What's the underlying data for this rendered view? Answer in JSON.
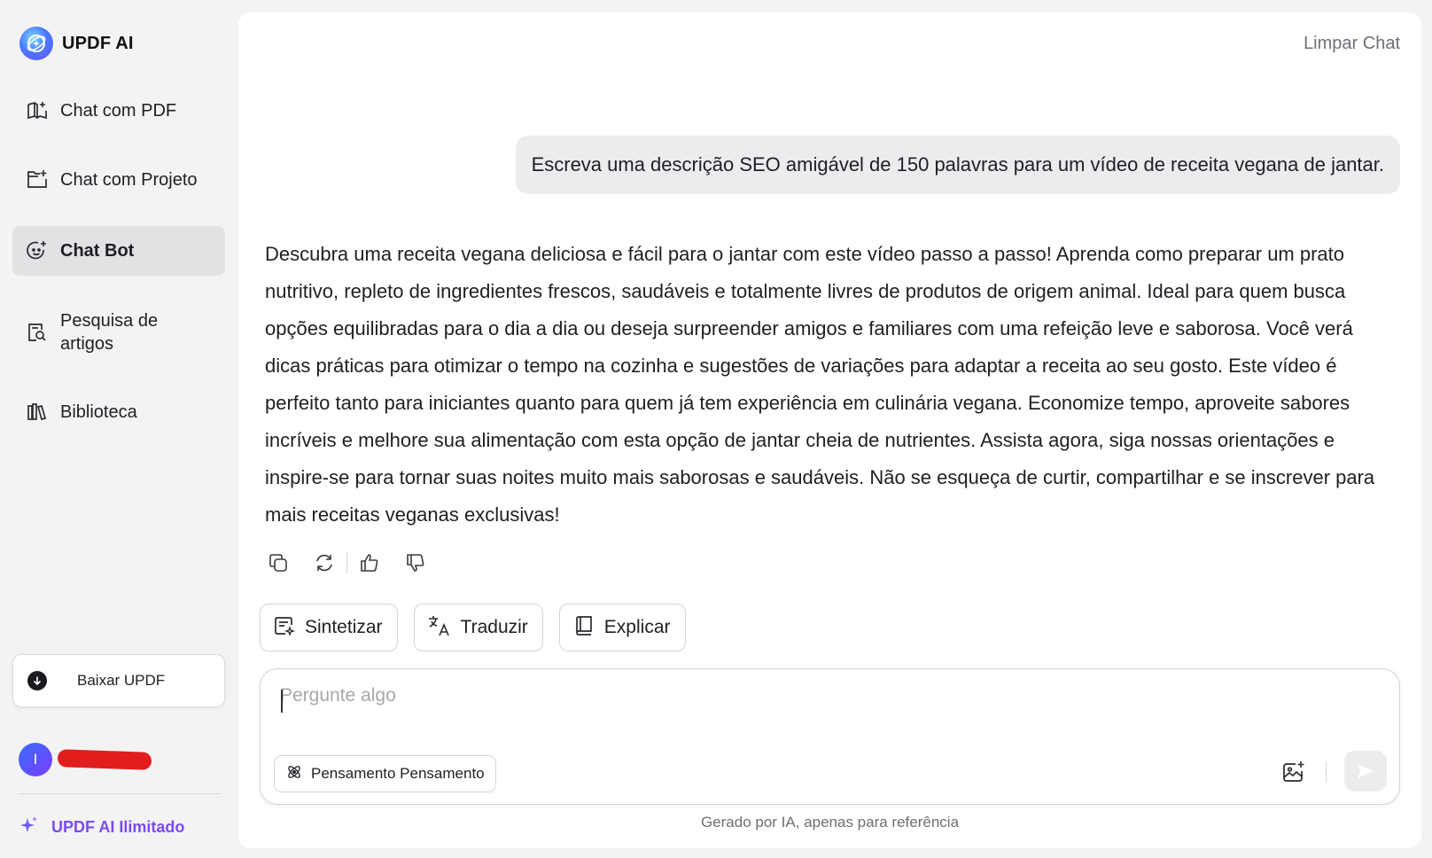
{
  "brand": {
    "name": "UPDF AI"
  },
  "sidebar": {
    "items": [
      {
        "label": "Chat com PDF",
        "icon": "book-sparkle-icon"
      },
      {
        "label": "Chat com Projeto",
        "icon": "folder-sparkle-icon"
      },
      {
        "label": "Chat Bot",
        "icon": "chatbot-icon",
        "active": true
      },
      {
        "label": "Pesquisa de artigos",
        "icon": "article-search-icon"
      },
      {
        "label": "Biblioteca",
        "icon": "library-icon"
      }
    ],
    "download_label": "Baixar UPDF",
    "user_initial": "I",
    "upgrade_label": "UPDF AI Ilimitado"
  },
  "header": {
    "clear_chat": "Limpar Chat"
  },
  "chat": {
    "user_message": "Escreva uma descrição SEO amigável de 150 palavras para um vídeo de receita vegana de jantar.",
    "bot_message": "Descubra uma receita vegana deliciosa e fácil para o jantar com este vídeo passo a passo! Aprenda como preparar um prato nutritivo, repleto de ingredientes frescos, saudáveis e totalmente livres de produtos de origem animal. Ideal para quem busca opções equilibradas para o dia a dia ou deseja surpreender amigos e familiares com uma refeição leve e saborosa. Você verá dicas práticas para otimizar o tempo na cozinha e sugestões de variações para adaptar a receita ao seu gosto. Este vídeo é perfeito tanto para iniciantes quanto para quem já tem experiência em culinária vegana. Economize tempo, aproveite sabores incríveis e melhore sua alimentação com esta opção de jantar cheia de nutrientes. Assista agora, siga nossas orientações e inspire-se para tornar suas noites muito mais saborosas e saudáveis. Não se esqueça de curtir, compartilhar e se inscrever para mais receitas veganas exclusivas!",
    "actions": [
      "copy-icon",
      "regenerate-icon",
      "thumbs-up-icon",
      "thumbs-down-icon"
    ]
  },
  "quick_actions": [
    {
      "label": "Sintetizar",
      "icon": "summarize-icon"
    },
    {
      "label": "Traduzir",
      "icon": "translate-icon"
    },
    {
      "label": "Explicar",
      "icon": "book-icon"
    }
  ],
  "input": {
    "placeholder": "Pergunte algo",
    "value": "",
    "thinking_label": "Pensamento Pensamento"
  },
  "footer": {
    "disclaimer": "Gerado por IA, apenas para referência"
  },
  "colors": {
    "accent": "#7a4cf0",
    "active_bg": "#e2e2e5",
    "redaction": "#e21d1d"
  }
}
